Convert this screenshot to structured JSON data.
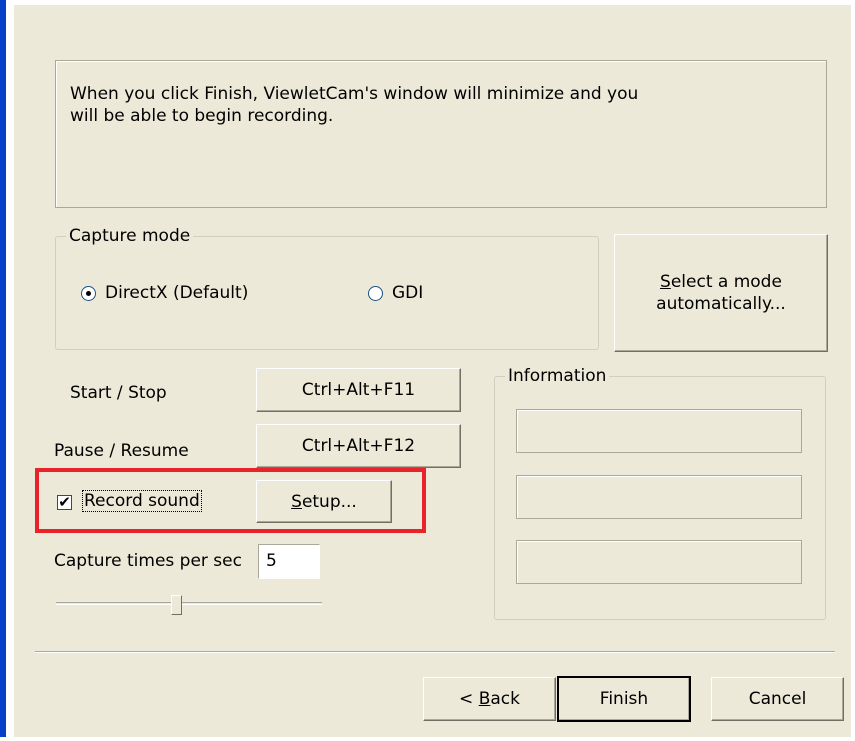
{
  "intro": {
    "line1": "When you click Finish, ViewletCam's window will minimize and you",
    "line2": "will be able to begin recording."
  },
  "capture_mode": {
    "legend": "Capture mode",
    "options": [
      {
        "label": "DirectX (Default)",
        "selected": true
      },
      {
        "label": "GDI",
        "selected": false
      }
    ]
  },
  "auto_mode_button": {
    "line1_prefix": "",
    "line1_accel": "S",
    "line1_rest": "elect a mode",
    "line2": "automatically..."
  },
  "hotkeys": {
    "start_stop_label": "Start / Stop",
    "start_stop_value": "Ctrl+Alt+F11",
    "pause_resume_label": "Pause / Resume",
    "pause_resume_value": "Ctrl+Alt+F12"
  },
  "sound": {
    "checkbox_label": "Record sound",
    "checked": true,
    "check_glyph": "✔",
    "setup_accel": "S",
    "setup_rest": "etup..."
  },
  "capture_rate": {
    "label": "Capture times per sec",
    "value": "5",
    "slider_position": 0.45
  },
  "information": {
    "legend": "Information",
    "fields": [
      "",
      "",
      ""
    ]
  },
  "footer": {
    "back_prefix": "< ",
    "back_accel": "B",
    "back_rest": "ack",
    "finish": "Finish",
    "cancel": "Cancel"
  },
  "colors": {
    "dialog_bg": "#ECE9D8",
    "highlight": "#E8232A",
    "title_blue": "#0A3FC8"
  }
}
